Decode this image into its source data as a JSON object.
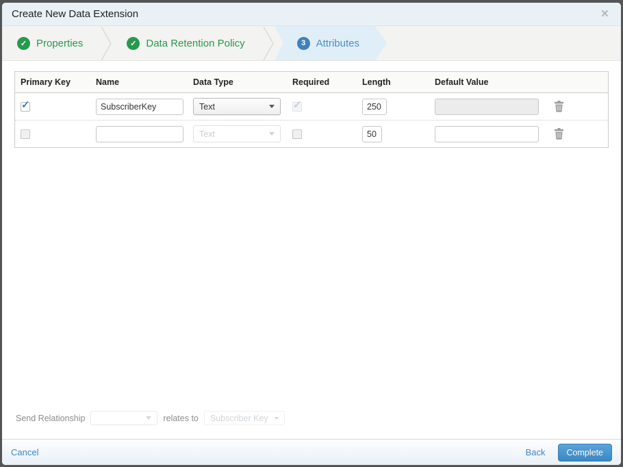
{
  "dialog": {
    "title": "Create New Data Extension",
    "close_icon": "×"
  },
  "steps": [
    {
      "label": "Properties",
      "status": "complete",
      "icon": "✓"
    },
    {
      "label": "Data Retention Policy",
      "status": "complete",
      "icon": "✓"
    },
    {
      "label": "Attributes",
      "status": "active",
      "number": "3"
    }
  ],
  "table": {
    "headers": [
      "Primary Key",
      "Name",
      "Data Type",
      "Required",
      "Length",
      "Default Value"
    ],
    "rows": [
      {
        "primary_key": true,
        "name": "SubscriberKey",
        "data_type": "Text",
        "required": true,
        "required_disabled": true,
        "length": "250",
        "default_value": "",
        "default_disabled": true
      },
      {
        "primary_key": false,
        "name": "",
        "data_type": "Text",
        "data_type_disabled": true,
        "required": false,
        "length": "50",
        "default_value": "",
        "default_disabled": false
      }
    ]
  },
  "send_relationship": {
    "label": "Send Relationship",
    "relates_to_label": "relates to",
    "target_field": "Subscriber Key"
  },
  "footer": {
    "cancel": "Cancel",
    "back": "Back",
    "complete": "Complete"
  },
  "colors": {
    "accent_green": "#26994e",
    "step_blue": "#4181b7",
    "link_blue": "#3e87c6",
    "titlebar_bg": "#eaf1f6",
    "active_step_bg": "#e0eef8"
  }
}
